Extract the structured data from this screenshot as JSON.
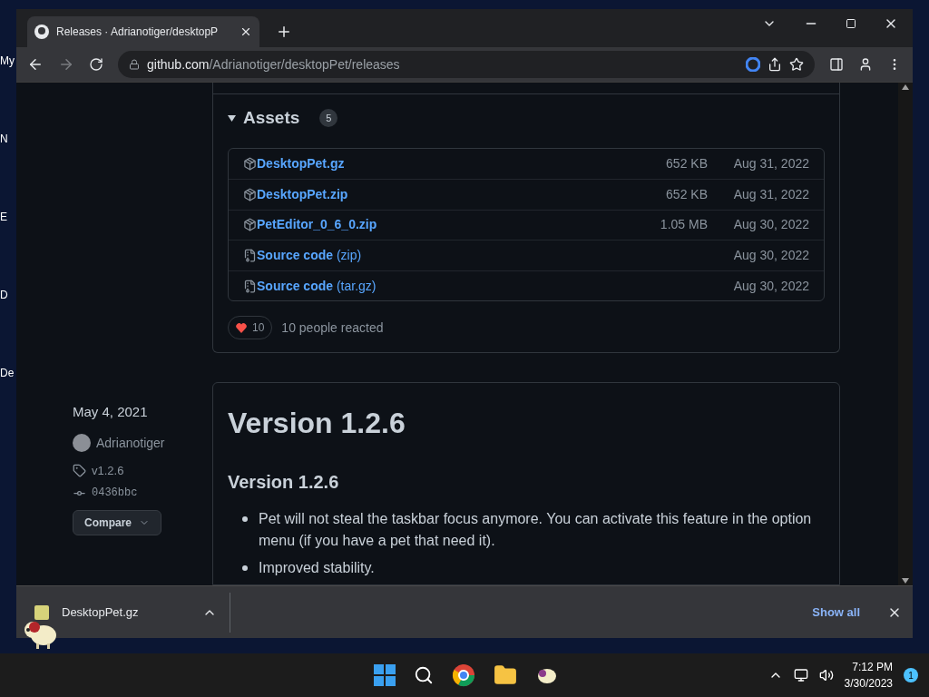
{
  "desktop": {
    "icon_labels": [
      "My",
      "N",
      "E",
      "D",
      "De"
    ]
  },
  "browser": {
    "tab": {
      "title": "Releases · Adrianotiger/desktopP",
      "selected": true
    },
    "address": {
      "host": "github.com",
      "path": "/Adrianotiger/desktopPet/releases"
    }
  },
  "assets": {
    "title": "Assets",
    "count": "5",
    "expanded": true,
    "items": [
      {
        "kind": "package",
        "name": "DesktopPet.gz",
        "size": "652 KB",
        "date": "Aug 31, 2022"
      },
      {
        "kind": "package",
        "name": "DesktopPet.zip",
        "size": "652 KB",
        "date": "Aug 31, 2022"
      },
      {
        "kind": "package",
        "name": "PetEditor_0_6_0.zip",
        "size": "1.05 MB",
        "date": "Aug 30, 2022"
      },
      {
        "kind": "source",
        "name": "Source code",
        "suffix": "(zip)",
        "date": "Aug 30, 2022"
      },
      {
        "kind": "source",
        "name": "Source code",
        "suffix": "(tar.gz)",
        "date": "Aug 30, 2022"
      }
    ]
  },
  "reactions": {
    "count": "10",
    "text": "10 people reacted"
  },
  "release": {
    "date": "May 4, 2021",
    "author": "Adrianotiger",
    "tag": "v1.2.6",
    "commit": "0436bbc",
    "compare": "Compare",
    "title": "Version 1.2.6",
    "heading": "Version 1.2.6",
    "notes": [
      "Pet will not steal the taskbar focus anymore. You can activate this feature in the option menu (if you have a pet that need it).",
      "Improved stability."
    ]
  },
  "download_bar": {
    "file": "DesktopPet.gz",
    "show_all": "Show all"
  },
  "taskbar": {
    "time": "7:12 PM",
    "date": "3/30/2023",
    "notifications": "1"
  }
}
